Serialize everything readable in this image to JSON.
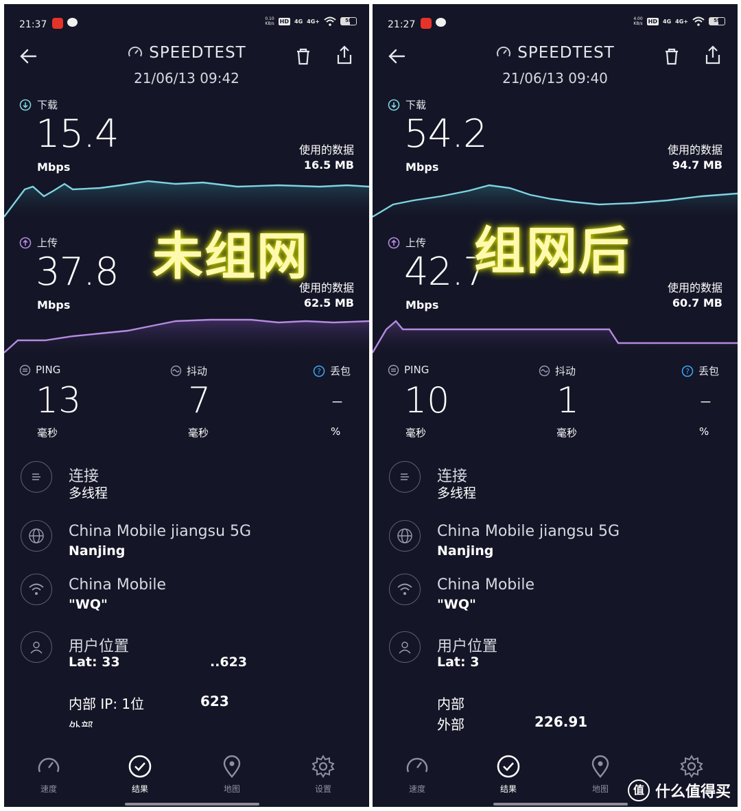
{
  "colors": {
    "background": "#141526",
    "download": "#7fd3e0",
    "upload": "#b58be0",
    "text": "#ffffff"
  },
  "panels": [
    {
      "status": {
        "time": "21:37",
        "app_badge": "",
        "net_speed_top": "0.10",
        "net_speed_bottom": "KB/s",
        "hd": "HD",
        "sig1": "4G",
        "sig2": "4G+",
        "battery": "58"
      },
      "header": {
        "title": "SPEEDTEST",
        "date": "21/06/13 09:42"
      },
      "download": {
        "label": "下载",
        "value": "15.4",
        "unit": "Mbps",
        "used_label": "使用的数据",
        "used_value": "16.5 MB"
      },
      "upload": {
        "label": "上传",
        "value": "37.8",
        "unit": "Mbps",
        "used_label": "使用的数据",
        "used_value": "62.5 MB"
      },
      "overlay": "未组网",
      "ping": {
        "label": "PING",
        "value": "13",
        "unit": "毫秒"
      },
      "jitter": {
        "label": "抖动",
        "value": "7",
        "unit": "毫秒"
      },
      "loss": {
        "label": "丢包",
        "value": "–",
        "unit": "%"
      },
      "connection": {
        "title": "连接",
        "sub": "多线程"
      },
      "server": {
        "title": "China Mobile jiangsu 5G",
        "sub": "Nanjing"
      },
      "provider": {
        "title": "China Mobile",
        "sub": "\"WQ\""
      },
      "location": {
        "title": "用户位置",
        "lat": "Lat: 33",
        "lat_tail": "..623"
      },
      "ip": {
        "internal": "内部 IP: 1位",
        "internal_tail": "623",
        "external": "外部"
      },
      "nav": {
        "speed": "速度",
        "results": "结果",
        "map": "地图",
        "settings": "设置"
      }
    },
    {
      "status": {
        "time": "21:27",
        "app_badge": "",
        "net_speed_top": "4.00",
        "net_speed_bottom": "KB/s",
        "hd": "HD",
        "sig1": "4G",
        "sig2": "4G+",
        "battery": "59"
      },
      "header": {
        "title": "SPEEDTEST",
        "date": "21/06/13 09:40"
      },
      "download": {
        "label": "下载",
        "value": "54.2",
        "unit": "Mbps",
        "used_label": "使用的数据",
        "used_value": "94.7 MB"
      },
      "upload": {
        "label": "上传",
        "value": "42.7",
        "unit": "Mbps",
        "used_label": "使用的数据",
        "used_value": "60.7 MB"
      },
      "overlay": "组网后",
      "ping": {
        "label": "PING",
        "value": "10",
        "unit": "毫秒"
      },
      "jitter": {
        "label": "抖动",
        "value": "1",
        "unit": "毫秒"
      },
      "loss": {
        "label": "丢包",
        "value": "–",
        "unit": "%"
      },
      "connection": {
        "title": "连接",
        "sub": "多线程"
      },
      "server": {
        "title": "China Mobile jiangsu 5G",
        "sub": "Nanjing"
      },
      "provider": {
        "title": "China Mobile",
        "sub": "\"WQ\""
      },
      "location": {
        "title": "用户位置",
        "lat": "Lat: 3",
        "lat_tail": ""
      },
      "ip": {
        "internal": "内部",
        "internal_tail": "",
        "external": "外部",
        "external_tail": "226.91"
      },
      "nav": {
        "speed": "速度",
        "results": "结果",
        "map": "地图",
        "settings": ""
      }
    }
  ],
  "watermark": {
    "logo": "值",
    "text": "什么值得买"
  }
}
